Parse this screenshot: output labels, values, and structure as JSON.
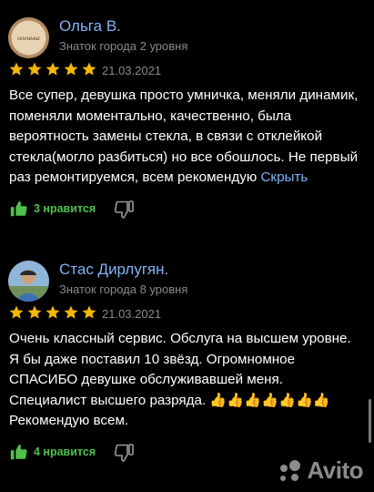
{
  "reviews": [
    {
      "author": "Ольга В.",
      "level": "Знаток города 2 уровня",
      "rating": 5,
      "date": "21.03.2021",
      "text": "Все супер, девушка просто умничка, меняли динамик, поменяли моментально, качественно, была вероятность замены стекла, в связи с отклейкой стекла(могло разбиться) но все обошлось. Не первый раз ремонтируемся, всем рекомендую",
      "hide_label": "Скрыть",
      "likes": "3 нравится",
      "avatar_text": "оленька"
    },
    {
      "author": "Стас Дирлугян.",
      "level": "Знаток города 8 уровня",
      "rating": 5,
      "date": "21.03.2021",
      "text": "Очень классный сервис. Обслуга на высшем уровне. Я бы даже поставил 10 звёзд. Огромномное СПАСИБО девушке обслуживавшей меня. Специалист высшего разряда. 👍👍👍👍👍👍👍 Рекомендую всем.",
      "likes": "4 нравится"
    }
  ],
  "watermark": "Avito",
  "colors": {
    "background": "#000000",
    "link": "#7fb2f5",
    "star": "#f5b800",
    "like": "#4fc14a",
    "muted": "#8a8a8a"
  }
}
